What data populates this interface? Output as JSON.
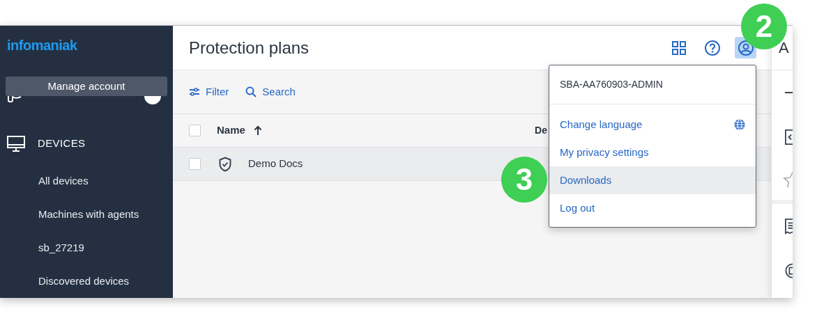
{
  "sidebar": {
    "logo": "infomaniak",
    "manage_button": "Manage account",
    "section": {
      "label": "DEVICES"
    },
    "items": [
      {
        "label": "All devices"
      },
      {
        "label": "Machines with agents"
      },
      {
        "label": "sb_27219"
      },
      {
        "label": "Discovered devices"
      }
    ]
  },
  "header": {
    "title": "Protection plans",
    "account_button": {
      "selected": true
    }
  },
  "toolbar": {
    "filter": "Filter",
    "search": "Search"
  },
  "table": {
    "select_all": {
      "checked": false
    },
    "columns": [
      {
        "label": "Name",
        "sort_ascending": true
      },
      {
        "label": "De"
      }
    ],
    "rows": [
      {
        "name": "Demo Docs",
        "checked": false,
        "selected": true
      }
    ]
  },
  "account_menu": {
    "user": "SBA-AA760903-ADMIN",
    "items": [
      {
        "label": "Change language",
        "kind": "language",
        "selected": false
      },
      {
        "label": "My privacy settings",
        "kind": "plain",
        "selected": false
      },
      {
        "label": "Downloads",
        "kind": "plain",
        "selected": true
      },
      {
        "label": "Log out",
        "kind": "plain",
        "selected": false
      }
    ]
  },
  "right_panel": {
    "title": "A"
  },
  "callouts": [
    {
      "label": "2"
    },
    {
      "label": "3"
    }
  ]
}
